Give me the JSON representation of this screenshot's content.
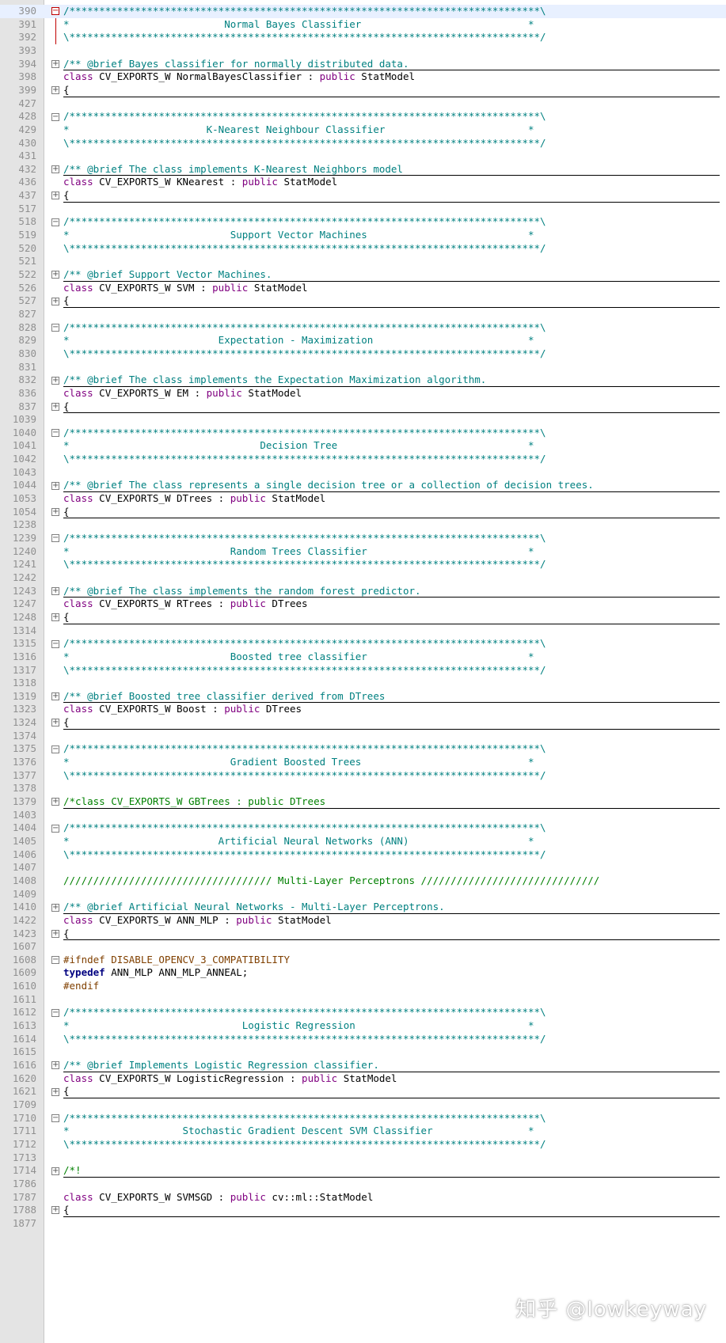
{
  "editor": {
    "lines": [
      {
        "n": "390",
        "text": "/*******************************************************************************\\",
        "style": "comment",
        "fold": "minus-red",
        "hl": true
      },
      {
        "n": "391",
        "text": "*                          Normal Bayes Classifier                            *",
        "style": "comment"
      },
      {
        "n": "392",
        "text": "\\*******************************************************************************/",
        "style": "comment"
      },
      {
        "n": "393",
        "text": "",
        "style": "plain"
      },
      {
        "n": "394",
        "text": "/** @brief Bayes classifier for normally distributed data.",
        "style": "doc",
        "fold": "plus"
      },
      {
        "n": "398",
        "text": "class CV_EXPORTS_W NormalBayesClassifier : public StatModel",
        "style": "class"
      },
      {
        "n": "399",
        "text": "{",
        "style": "plain",
        "fold": "plus"
      },
      {
        "n": "427",
        "text": "",
        "style": "plain"
      },
      {
        "n": "428",
        "text": "/*******************************************************************************\\",
        "style": "comment",
        "fold": "minus"
      },
      {
        "n": "429",
        "text": "*                       K-Nearest Neighbour Classifier                        *",
        "style": "comment"
      },
      {
        "n": "430",
        "text": "\\*******************************************************************************/",
        "style": "comment"
      },
      {
        "n": "431",
        "text": "",
        "style": "plain"
      },
      {
        "n": "432",
        "text": "/** @brief The class implements K-Nearest Neighbors model",
        "style": "doc",
        "fold": "plus"
      },
      {
        "n": "436",
        "text": "class CV_EXPORTS_W KNearest : public StatModel",
        "style": "class"
      },
      {
        "n": "437",
        "text": "{",
        "style": "plain",
        "fold": "plus"
      },
      {
        "n": "517",
        "text": "",
        "style": "plain"
      },
      {
        "n": "518",
        "text": "/*******************************************************************************\\",
        "style": "comment",
        "fold": "minus"
      },
      {
        "n": "519",
        "text": "*                           Support Vector Machines                           *",
        "style": "comment"
      },
      {
        "n": "520",
        "text": "\\*******************************************************************************/",
        "style": "comment"
      },
      {
        "n": "521",
        "text": "",
        "style": "plain"
      },
      {
        "n": "522",
        "text": "/** @brief Support Vector Machines.",
        "style": "doc",
        "fold": "plus"
      },
      {
        "n": "526",
        "text": "class CV_EXPORTS_W SVM : public StatModel",
        "style": "class"
      },
      {
        "n": "527",
        "text": "{",
        "style": "plain",
        "fold": "plus"
      },
      {
        "n": "827",
        "text": "",
        "style": "plain"
      },
      {
        "n": "828",
        "text": "/*******************************************************************************\\",
        "style": "comment",
        "fold": "minus"
      },
      {
        "n": "829",
        "text": "*                         Expectation - Maximization                          *",
        "style": "comment"
      },
      {
        "n": "830",
        "text": "\\*******************************************************************************/",
        "style": "comment"
      },
      {
        "n": "831",
        "text": "",
        "style": "plain"
      },
      {
        "n": "832",
        "text": "/** @brief The class implements the Expectation Maximization algorithm.",
        "style": "doc",
        "fold": "plus"
      },
      {
        "n": "836",
        "text": "class CV_EXPORTS_W EM : public StatModel",
        "style": "class"
      },
      {
        "n": "837",
        "text": "{",
        "style": "plain",
        "fold": "plus"
      },
      {
        "n": "1039",
        "text": "",
        "style": "plain"
      },
      {
        "n": "1040",
        "text": "/*******************************************************************************\\",
        "style": "comment",
        "fold": "minus"
      },
      {
        "n": "1041",
        "text": "*                                Decision Tree                                *",
        "style": "comment"
      },
      {
        "n": "1042",
        "text": "\\*******************************************************************************/",
        "style": "comment"
      },
      {
        "n": "1043",
        "text": "",
        "style": "plain"
      },
      {
        "n": "1044",
        "text": "/** @brief The class represents a single decision tree or a collection of decision trees.",
        "style": "doc",
        "fold": "plus"
      },
      {
        "n": "1053",
        "text": "class CV_EXPORTS_W DTrees : public StatModel",
        "style": "class"
      },
      {
        "n": "1054",
        "text": "{",
        "style": "plain",
        "fold": "plus"
      },
      {
        "n": "1238",
        "text": "",
        "style": "plain"
      },
      {
        "n": "1239",
        "text": "/*******************************************************************************\\",
        "style": "comment",
        "fold": "minus"
      },
      {
        "n": "1240",
        "text": "*                           Random Trees Classifier                           *",
        "style": "comment"
      },
      {
        "n": "1241",
        "text": "\\*******************************************************************************/",
        "style": "comment"
      },
      {
        "n": "1242",
        "text": "",
        "style": "plain"
      },
      {
        "n": "1243",
        "text": "/** @brief The class implements the random forest predictor.",
        "style": "doc",
        "fold": "plus"
      },
      {
        "n": "1247",
        "text": "class CV_EXPORTS_W RTrees : public DTrees",
        "style": "class"
      },
      {
        "n": "1248",
        "text": "{",
        "style": "plain",
        "fold": "plus"
      },
      {
        "n": "1314",
        "text": "",
        "style": "plain"
      },
      {
        "n": "1315",
        "text": "/*******************************************************************************\\",
        "style": "comment",
        "fold": "minus"
      },
      {
        "n": "1316",
        "text": "*                           Boosted tree classifier                           *",
        "style": "comment"
      },
      {
        "n": "1317",
        "text": "\\*******************************************************************************/",
        "style": "comment"
      },
      {
        "n": "1318",
        "text": "",
        "style": "plain"
      },
      {
        "n": "1319",
        "text": "/** @brief Boosted tree classifier derived from DTrees",
        "style": "doc",
        "fold": "plus"
      },
      {
        "n": "1323",
        "text": "class CV_EXPORTS_W Boost : public DTrees",
        "style": "class"
      },
      {
        "n": "1324",
        "text": "{",
        "style": "plain",
        "fold": "plus"
      },
      {
        "n": "1374",
        "text": "",
        "style": "plain"
      },
      {
        "n": "1375",
        "text": "/*******************************************************************************\\",
        "style": "comment",
        "fold": "minus"
      },
      {
        "n": "1376",
        "text": "*                           Gradient Boosted Trees                            *",
        "style": "comment"
      },
      {
        "n": "1377",
        "text": "\\*******************************************************************************/",
        "style": "comment"
      },
      {
        "n": "1378",
        "text": "",
        "style": "plain"
      },
      {
        "n": "1379",
        "text": "/*class CV_EXPORTS_W GBTrees : public DTrees",
        "style": "green",
        "fold": "plus"
      },
      {
        "n": "1403",
        "text": "",
        "style": "plain"
      },
      {
        "n": "1404",
        "text": "/*******************************************************************************\\",
        "style": "comment",
        "fold": "minus"
      },
      {
        "n": "1405",
        "text": "*                         Artificial Neural Networks (ANN)                    *",
        "style": "comment"
      },
      {
        "n": "1406",
        "text": "\\*******************************************************************************/",
        "style": "comment"
      },
      {
        "n": "1407",
        "text": "",
        "style": "plain"
      },
      {
        "n": "1408",
        "text": "/////////////////////////////////// Multi-Layer Perceptrons //////////////////////////////",
        "style": "green"
      },
      {
        "n": "1409",
        "text": "",
        "style": "plain"
      },
      {
        "n": "1410",
        "text": "/** @brief Artificial Neural Networks - Multi-Layer Perceptrons.",
        "style": "doc",
        "fold": "plus"
      },
      {
        "n": "1422",
        "text": "class CV_EXPORTS_W ANN_MLP : public StatModel",
        "style": "class"
      },
      {
        "n": "1423",
        "text": "{",
        "style": "plain",
        "fold": "plus"
      },
      {
        "n": "1607",
        "text": "",
        "style": "plain"
      },
      {
        "n": "1608",
        "text": "#ifndef DISABLE_OPENCV_3_COMPATIBILITY",
        "style": "pre",
        "fold": "minus"
      },
      {
        "n": "1609",
        "text": "typedef ANN_MLP ANN_MLP_ANNEAL;",
        "style": "typedef"
      },
      {
        "n": "1610",
        "text": "#endif",
        "style": "pre"
      },
      {
        "n": "1611",
        "text": "",
        "style": "plain"
      },
      {
        "n": "1612",
        "text": "/*******************************************************************************\\",
        "style": "comment",
        "fold": "minus"
      },
      {
        "n": "1613",
        "text": "*                             Logistic Regression                             *",
        "style": "comment"
      },
      {
        "n": "1614",
        "text": "\\*******************************************************************************/",
        "style": "comment"
      },
      {
        "n": "1615",
        "text": "",
        "style": "plain"
      },
      {
        "n": "1616",
        "text": "/** @brief Implements Logistic Regression classifier.",
        "style": "doc",
        "fold": "plus"
      },
      {
        "n": "1620",
        "text": "class CV_EXPORTS_W LogisticRegression : public StatModel",
        "style": "class"
      },
      {
        "n": "1621",
        "text": "{",
        "style": "plain",
        "fold": "plus"
      },
      {
        "n": "1709",
        "text": "",
        "style": "plain"
      },
      {
        "n": "1710",
        "text": "/*******************************************************************************\\",
        "style": "comment",
        "fold": "minus"
      },
      {
        "n": "1711",
        "text": "*                   Stochastic Gradient Descent SVM Classifier                *",
        "style": "comment"
      },
      {
        "n": "1712",
        "text": "\\*******************************************************************************/",
        "style": "comment"
      },
      {
        "n": "1713",
        "text": "",
        "style": "plain"
      },
      {
        "n": "1714",
        "text": "/*!",
        "style": "green",
        "fold": "plus"
      },
      {
        "n": "1786",
        "text": "",
        "style": "plain"
      },
      {
        "n": "1787",
        "text": "class CV_EXPORTS_W SVMSGD : public cv::ml::StatModel",
        "style": "class"
      },
      {
        "n": "1788",
        "text": "{",
        "style": "plain",
        "fold": "plus"
      },
      {
        "n": "1877",
        "text": "",
        "style": "plain"
      }
    ]
  },
  "watermark": "知乎 @lowkeyway"
}
